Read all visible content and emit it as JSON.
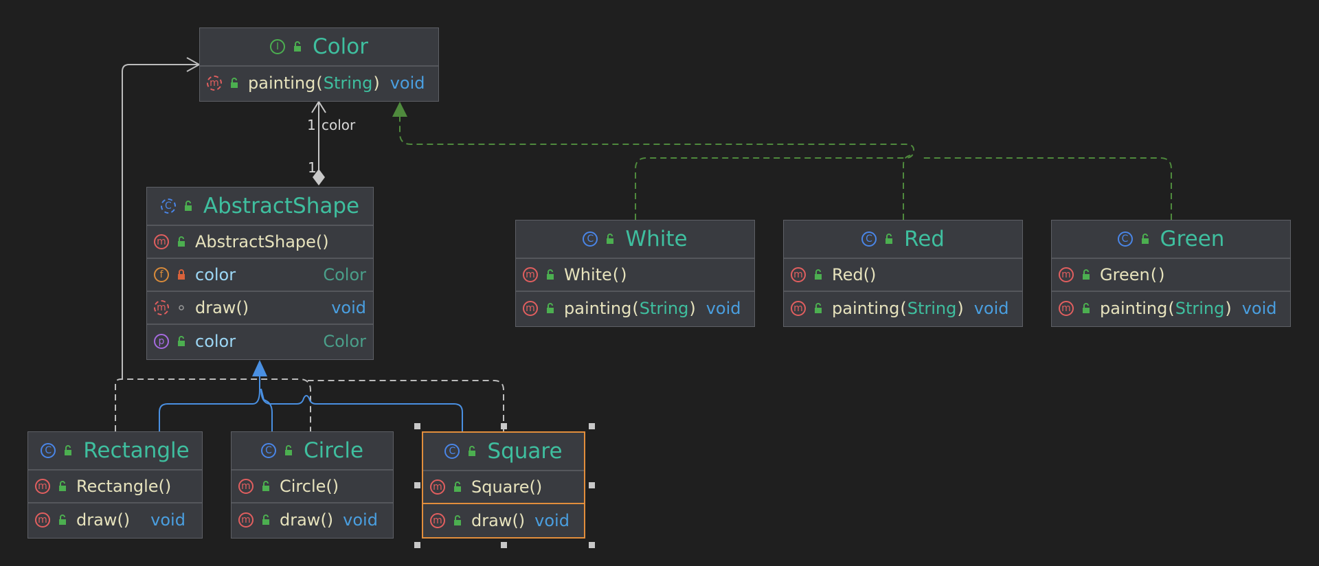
{
  "diagram": {
    "classes": {
      "color": {
        "kind": "interface",
        "kind_badge": "I",
        "name": "Color",
        "members": [
          {
            "badge": "m",
            "name": "painting",
            "param": "String",
            "type": "void"
          }
        ]
      },
      "abstract_shape": {
        "kind": "abstract-class",
        "kind_badge": "C",
        "name": "AbstractShape",
        "members": [
          {
            "badge": "m",
            "name": "AbstractShape()",
            "type": ""
          },
          {
            "badge": "f",
            "name": "color",
            "type": "Color"
          },
          {
            "badge": "m",
            "name": "draw()",
            "type": "void"
          },
          {
            "badge": "p",
            "name": "color",
            "type": "Color"
          }
        ]
      },
      "white": {
        "kind": "class",
        "kind_badge": "C",
        "name": "White",
        "members": [
          {
            "badge": "m",
            "name": "White",
            "param": "",
            "type": ""
          },
          {
            "badge": "m",
            "name": "painting",
            "param": "String",
            "type": "void"
          }
        ]
      },
      "red": {
        "kind": "class",
        "kind_badge": "C",
        "name": "Red",
        "members": [
          {
            "badge": "m",
            "name": "Red()",
            "type": ""
          },
          {
            "badge": "m",
            "name": "painting",
            "param": "String",
            "type": "void"
          }
        ]
      },
      "green": {
        "kind": "class",
        "kind_badge": "C",
        "name": "Green",
        "members": [
          {
            "badge": "m",
            "name": "Green",
            "param": "",
            "type": ""
          },
          {
            "badge": "m",
            "name": "painting",
            "param": "String",
            "type": "void"
          }
        ]
      },
      "rectangle": {
        "kind": "class",
        "kind_badge": "C",
        "name": "Rectangle",
        "members": [
          {
            "badge": "m",
            "name": "Rectangle()",
            "type": ""
          },
          {
            "badge": "m",
            "name": "draw()",
            "type": "void"
          }
        ]
      },
      "circle": {
        "kind": "class",
        "kind_badge": "C",
        "name": "Circle",
        "members": [
          {
            "badge": "m",
            "name": "Circle()",
            "type": ""
          },
          {
            "badge": "m",
            "name": "draw()",
            "type": "void"
          }
        ]
      },
      "square": {
        "kind": "class",
        "kind_badge": "C",
        "name": "Square",
        "selected": true,
        "members": [
          {
            "badge": "m",
            "name": "Square()",
            "type": ""
          },
          {
            "badge": "m",
            "name": "draw()",
            "type": "void"
          }
        ]
      }
    },
    "relations": {
      "composition": {
        "from": "AbstractShape",
        "to": "Color",
        "target_multiplicity": "1",
        "target_role": "color",
        "source_multiplicity": "1"
      },
      "implements": [
        "White",
        "Red",
        "Green"
      ],
      "extends": [
        "Rectangle",
        "Circle",
        "Square"
      ]
    },
    "colors": {
      "background": "#1f1f1f",
      "node_fill": "#393b40",
      "class_name": "#3fbf9f",
      "realization_edge": "#4f8a3d",
      "generalization_edge": "#4a90e2",
      "dependency_edge": "#bdbdbd",
      "selection": "#e28e3c"
    }
  }
}
